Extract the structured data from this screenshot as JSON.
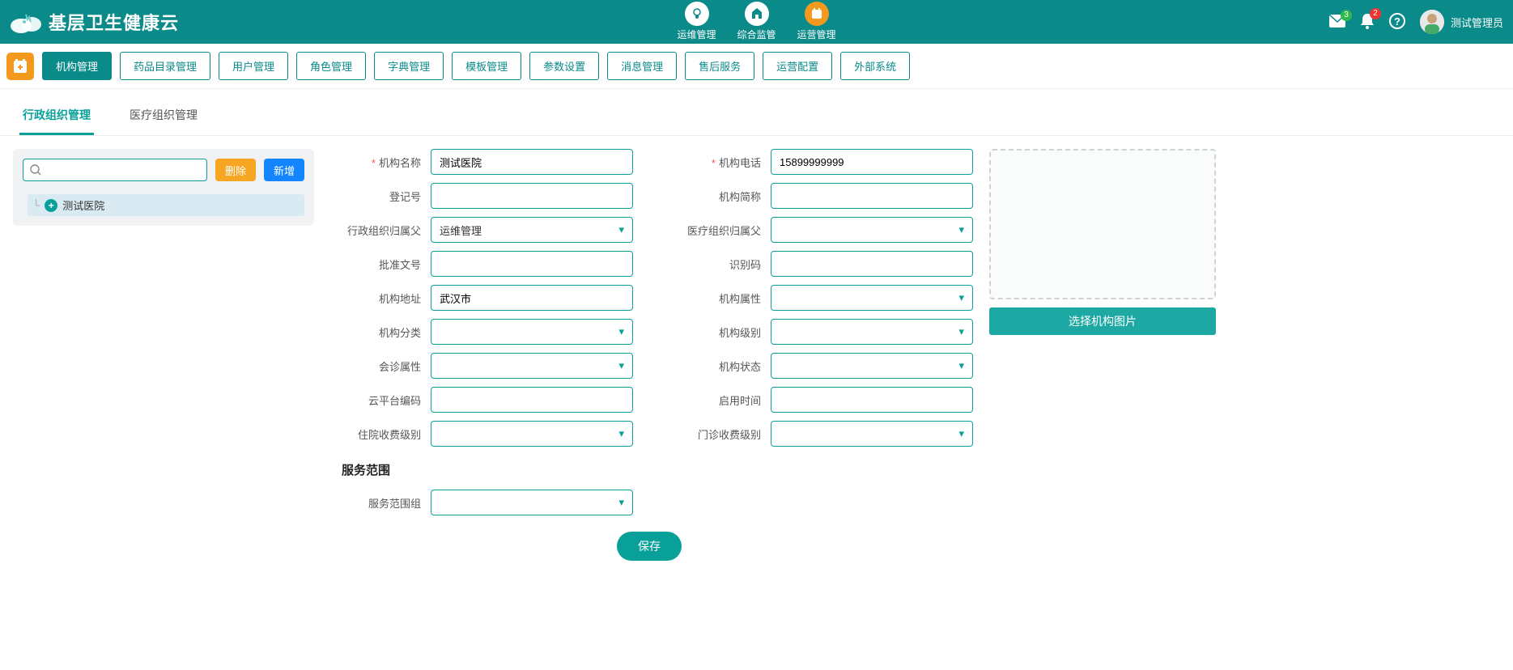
{
  "header": {
    "app_name": "基层卫生健康云",
    "nav": [
      {
        "label": "运维管理"
      },
      {
        "label": "综合监管"
      },
      {
        "label": "运营管理"
      }
    ],
    "mail_badge": "3",
    "bell_badge": "2",
    "user_name": "测试管理员"
  },
  "toolbar": {
    "items": [
      "机构管理",
      "药品目录管理",
      "用户管理",
      "角色管理",
      "字典管理",
      "模板管理",
      "参数设置",
      "消息管理",
      "售后服务",
      "运营配置",
      "外部系统"
    ],
    "active": "机构管理"
  },
  "tabs": {
    "items": [
      "行政组织管理",
      "医疗组织管理"
    ],
    "active": "行政组织管理"
  },
  "left_panel": {
    "search_placeholder": "",
    "delete_label": "删除",
    "add_label": "新增",
    "tree": {
      "root_label": "测试医院"
    }
  },
  "form": {
    "org_name": {
      "label": "机构名称",
      "value": "测试医院",
      "required": true
    },
    "org_phone": {
      "label": "机构电话",
      "value": "15899999999",
      "required": true
    },
    "reg_no": {
      "label": "登记号",
      "value": ""
    },
    "org_short": {
      "label": "机构简称",
      "value": ""
    },
    "admin_parent": {
      "label": "行政组织归属父",
      "value": "运维管理"
    },
    "med_parent": {
      "label": "医疗组织归属父",
      "value": ""
    },
    "approve_no": {
      "label": "批准文号",
      "value": ""
    },
    "ident_code": {
      "label": "识别码",
      "value": ""
    },
    "org_addr": {
      "label": "机构地址",
      "value": "武汉市"
    },
    "org_attr": {
      "label": "机构属性",
      "value": ""
    },
    "org_cat": {
      "label": "机构分类",
      "value": ""
    },
    "org_level": {
      "label": "机构级别",
      "value": ""
    },
    "consult_attr": {
      "label": "会诊属性",
      "value": ""
    },
    "org_status": {
      "label": "机构状态",
      "value": ""
    },
    "cloud_code": {
      "label": "云平台编码",
      "value": ""
    },
    "enable_time": {
      "label": "启用时间",
      "value": ""
    },
    "inpatient_level": {
      "label": "住院收费级别",
      "value": ""
    },
    "outpatient_level": {
      "label": "门诊收费级别",
      "value": ""
    },
    "service_scope_title": "服务范围",
    "service_scope_group": {
      "label": "服务范围组",
      "value": ""
    },
    "save_label": "保存"
  },
  "upload": {
    "button_label": "选择机构图片"
  }
}
